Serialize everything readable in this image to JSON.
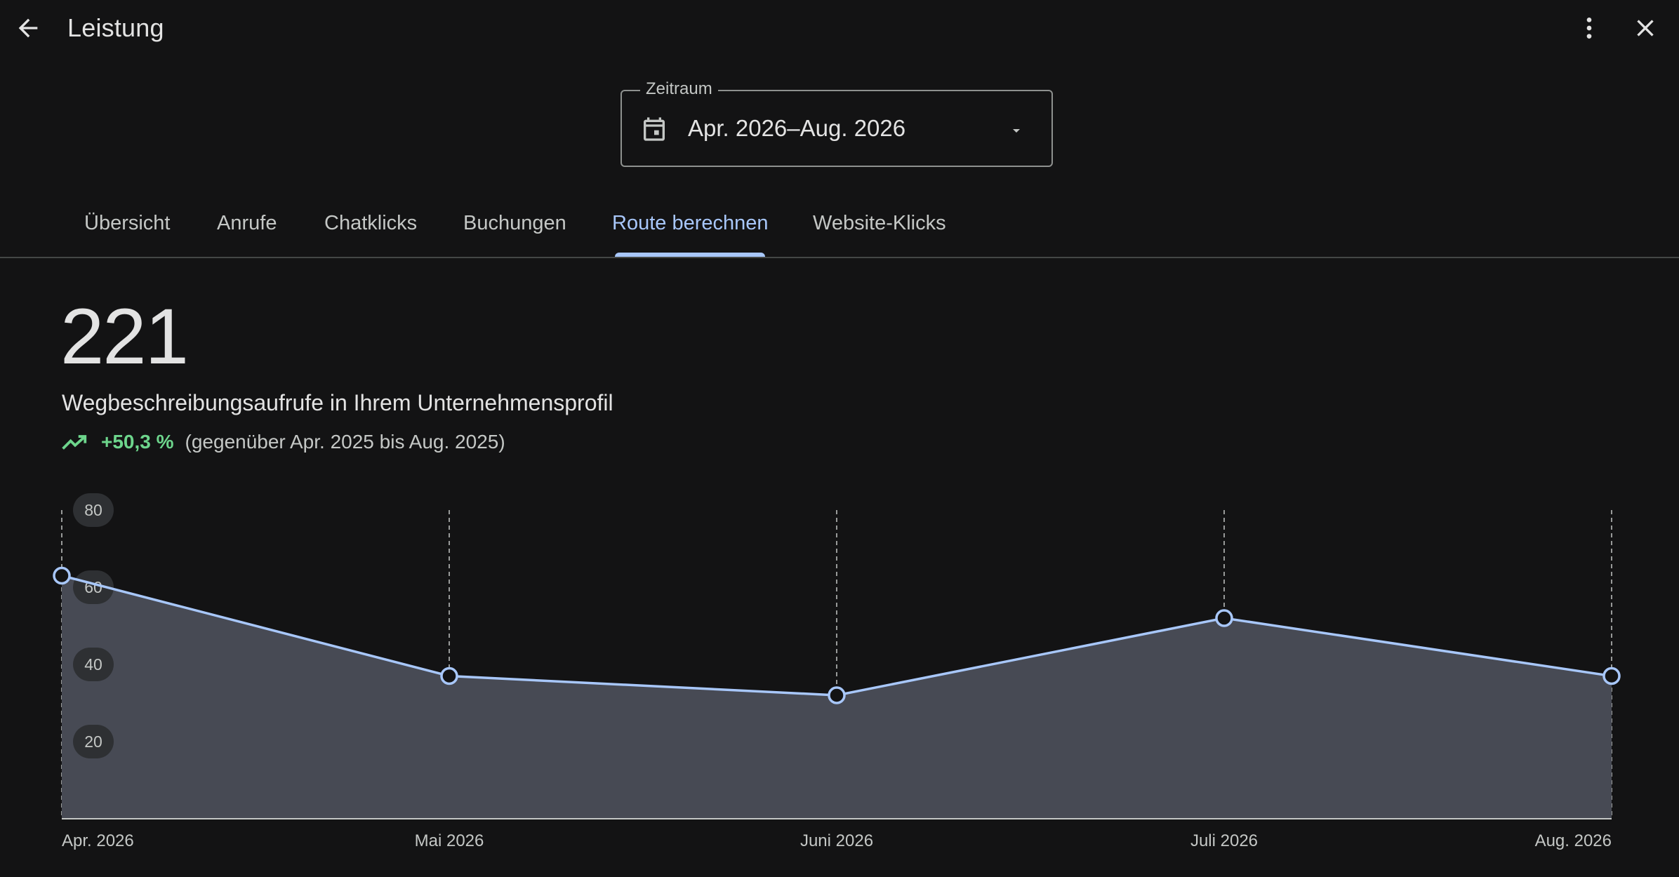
{
  "header": {
    "title": "Leistung",
    "back_icon": "arrow-back-icon",
    "more_icon": "more-vert-icon",
    "close_icon": "close-icon"
  },
  "date_range": {
    "label": "Zeitraum",
    "value": "Apr. 2026–Aug. 2026",
    "icon": "calendar-icon",
    "dropdown_icon": "arrow-drop-down-icon"
  },
  "tabs": [
    {
      "label": "Übersicht",
      "active": false
    },
    {
      "label": "Anrufe",
      "active": false
    },
    {
      "label": "Chatklicks",
      "active": false
    },
    {
      "label": "Buchungen",
      "active": false
    },
    {
      "label": "Route berechnen",
      "active": true
    },
    {
      "label": "Website-Klicks",
      "active": false
    }
  ],
  "metric": {
    "total": "221",
    "label": "Wegbeschreibungsaufrufe in Ihrem Unternehmensprofil",
    "trend_icon": "trending-up-icon",
    "change": "+50,3 %",
    "comparison": "(gegenüber Apr. 2025 bis Aug. 2025)"
  },
  "colors": {
    "background": "#131314",
    "accent": "#a8c7fa",
    "positive": "#6dd58c",
    "area_fill": "#474a54"
  },
  "chart_data": {
    "type": "area",
    "categories": [
      "Apr. 2026",
      "Mai 2026",
      "Juni 2026",
      "Juli 2026",
      "Aug. 2026"
    ],
    "values": [
      63,
      37,
      32,
      52,
      37
    ],
    "yticks": [
      20,
      40,
      60,
      80
    ],
    "ylim": [
      0,
      80
    ],
    "grid": "vertical dashed",
    "markers": true
  }
}
